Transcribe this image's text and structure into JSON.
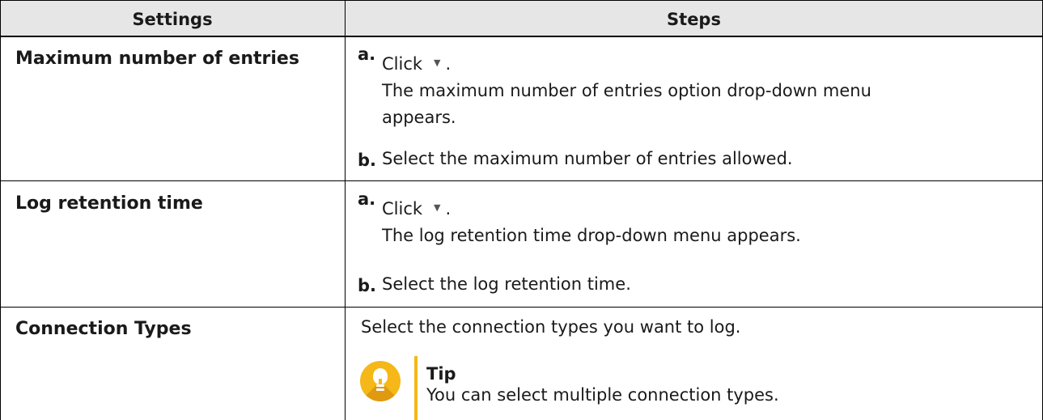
{
  "table": {
    "headers": [
      "Settings",
      "Steps"
    ],
    "rows": [
      {
        "setting": "Maximum number of entries",
        "steps": [
          {
            "label": "a.",
            "text_before": "Click",
            "text_after": ".",
            "desc": "The maximum number of entries option drop-down menu",
            "desc2": "appears."
          },
          {
            "label": "b.",
            "text": "Select the maximum number of entries allowed."
          }
        ]
      },
      {
        "setting": "Log retention time",
        "steps": [
          {
            "label": "a.",
            "text_before": "Click",
            "text_after": ".",
            "desc": "The log retention time drop-down menu appears."
          },
          {
            "label": "b.",
            "text": "Select the log retention time."
          }
        ]
      },
      {
        "setting": "Connection Types",
        "text": "Select the connection types you want to log.",
        "tip": {
          "title": "Tip",
          "text": "You can select multiple connection types.",
          "icon": "lightbulb-icon"
        }
      }
    ]
  },
  "icons": {
    "dropdown": "caret-down-icon",
    "tip": "lightbulb-icon"
  },
  "colors": {
    "header_bg": "#e6e6e6",
    "tip_accent": "#f5b818"
  }
}
